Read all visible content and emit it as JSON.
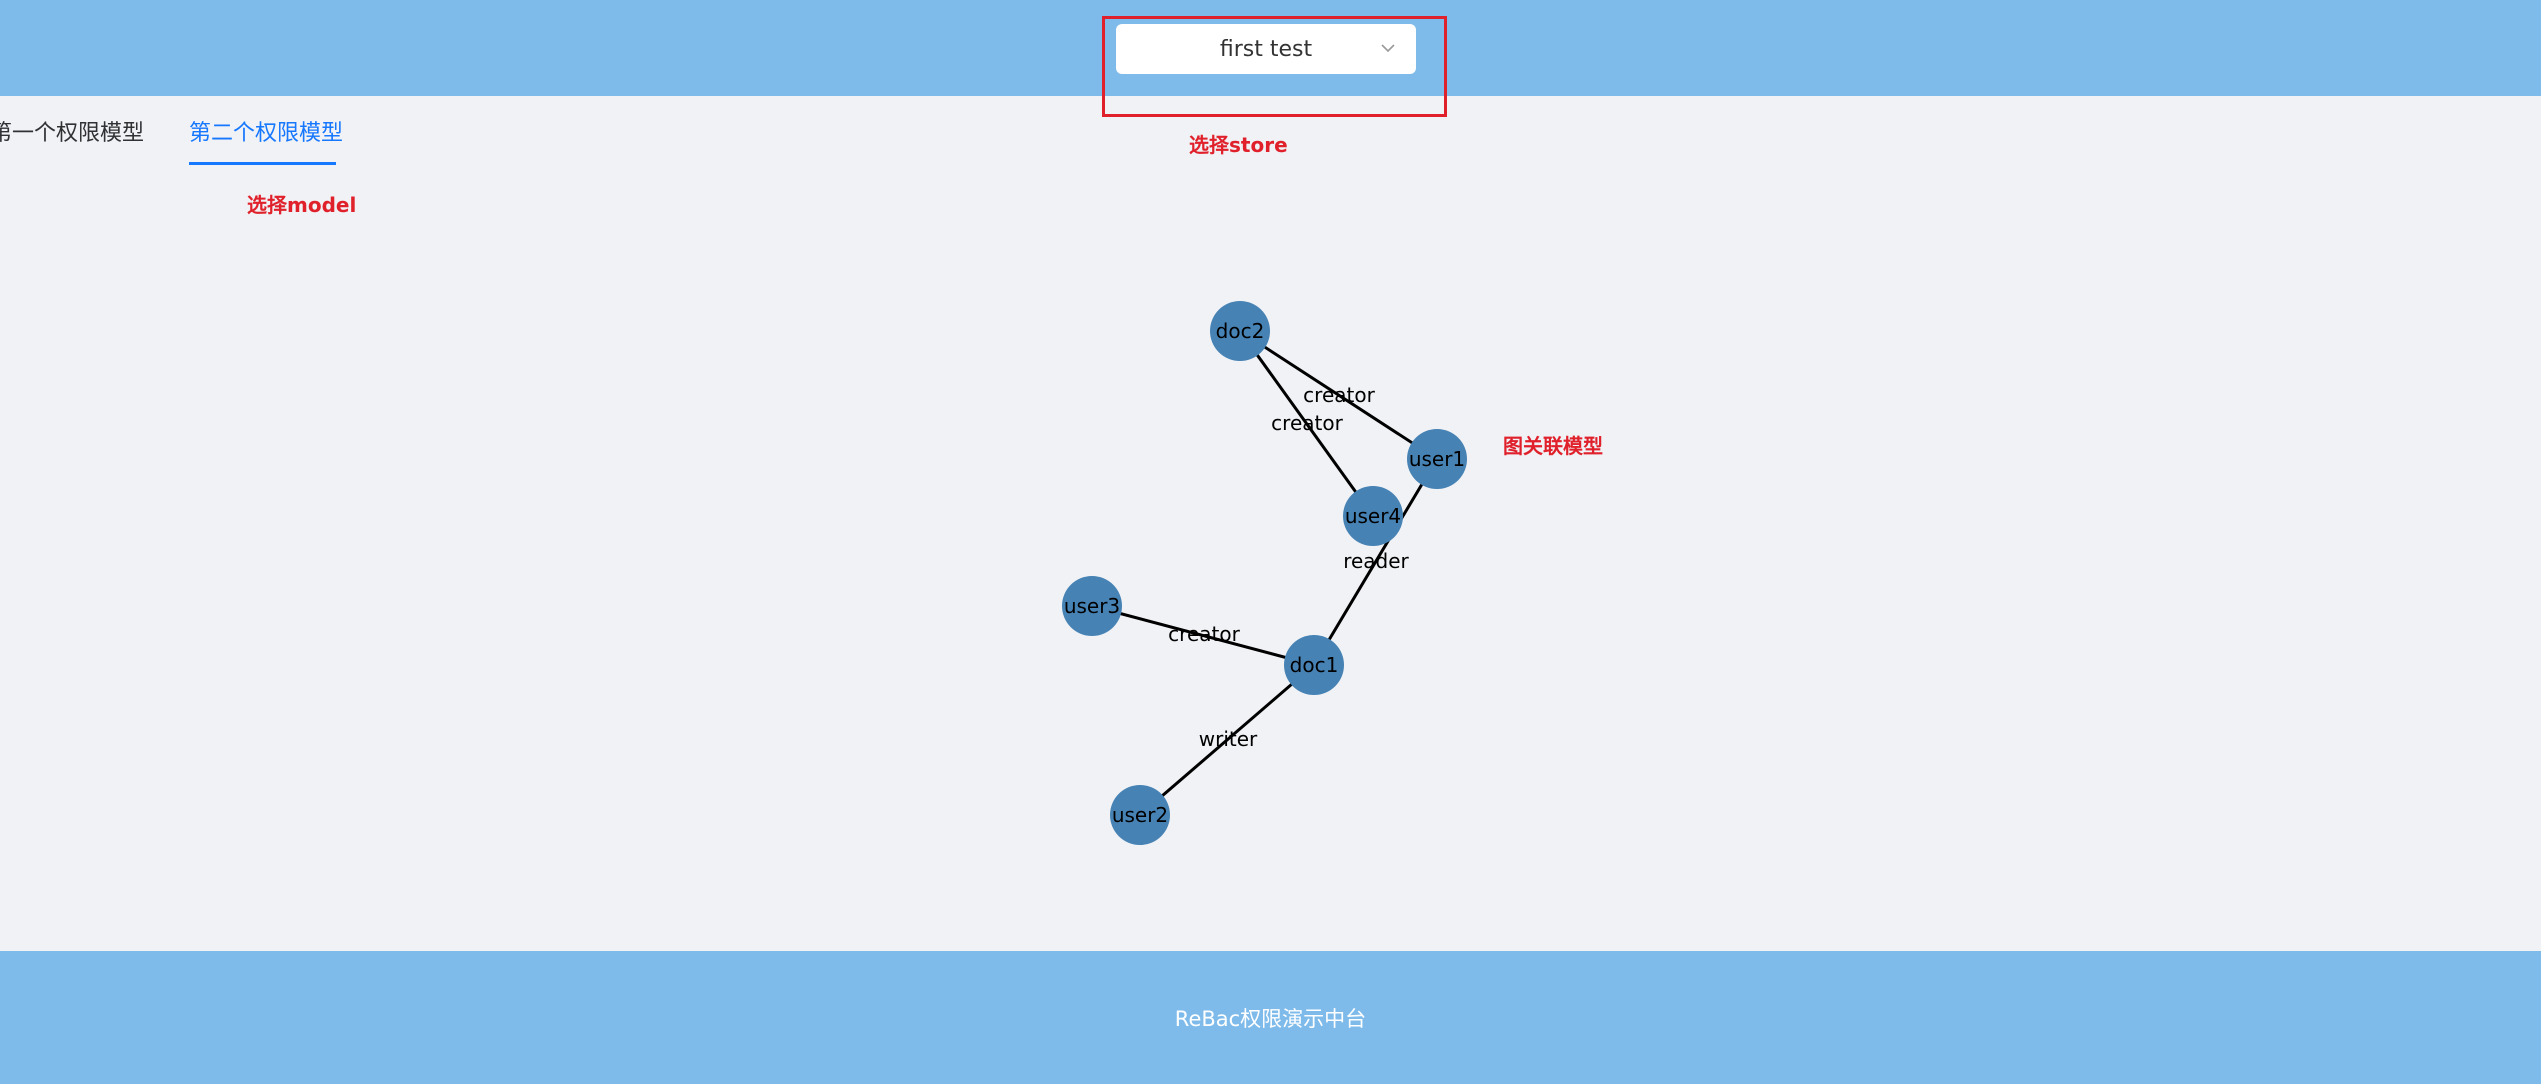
{
  "header": {
    "store_select": {
      "value": "first test",
      "icon": "chevron-down-icon"
    }
  },
  "annotations": {
    "select_store": "选择store",
    "select_model": "选择model",
    "graph_model": "图关联模型"
  },
  "tabs": [
    {
      "label": "第一个权限模型",
      "active": false
    },
    {
      "label": "第二个权限模型",
      "active": true
    }
  ],
  "graph": {
    "node_color": "#4682b4",
    "nodes": [
      {
        "id": "doc2",
        "label": "doc2"
      },
      {
        "id": "user1",
        "label": "user1"
      },
      {
        "id": "user4",
        "label": "user4"
      },
      {
        "id": "user3",
        "label": "user3"
      },
      {
        "id": "doc1",
        "label": "doc1"
      },
      {
        "id": "user2",
        "label": "user2"
      }
    ],
    "edges": [
      {
        "source": "doc2",
        "target": "user1",
        "label": "creator"
      },
      {
        "source": "doc2",
        "target": "user4",
        "label": "creator"
      },
      {
        "source": "user1",
        "target": "doc1",
        "label": "reader"
      },
      {
        "source": "user3",
        "target": "doc1",
        "label": "creator"
      },
      {
        "source": "user2",
        "target": "doc1",
        "label": "writer"
      }
    ]
  },
  "footer": {
    "text": "ReBac权限演示中台"
  }
}
